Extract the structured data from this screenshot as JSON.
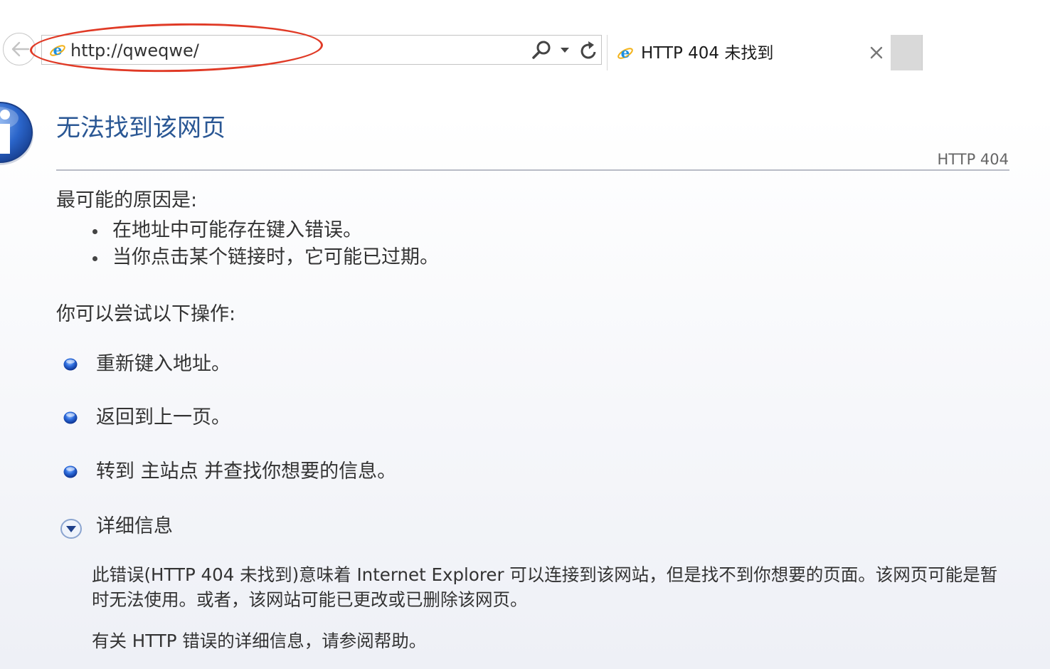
{
  "browser": {
    "address": "http://qweqwe/",
    "tab_title": "HTTP 404 未找到",
    "icons": [
      "back-arrow-icon",
      "ie-logo-icon",
      "search-icon",
      "dropdown-icon",
      "refresh-icon",
      "close-icon"
    ],
    "highlight_color": "#e03a26"
  },
  "page": {
    "title": "无法找到该网页",
    "code": "HTTP 404",
    "causes_heading": "最可能的原因是:",
    "causes": [
      "在地址中可能存在键入错误。",
      "当你点击某个链接时，它可能已过期。"
    ],
    "try_heading": "你可以尝试以下操作:",
    "actions": [
      "重新键入地址。",
      "返回到上一页。",
      "转到 主站点 并查找你想要的信息。"
    ],
    "details_label": "详细信息",
    "details_text": "此错误(HTTP 404 未找到)意味着 Internet Explorer 可以连接到该网站，但是找不到你想要的页面。该网页可能是暂时无法使用。或者，该网站可能已更改或已删除该网页。",
    "help_text": "有关 HTTP 错误的详细信息，请参阅帮助。",
    "title_color": "#2a5794"
  }
}
